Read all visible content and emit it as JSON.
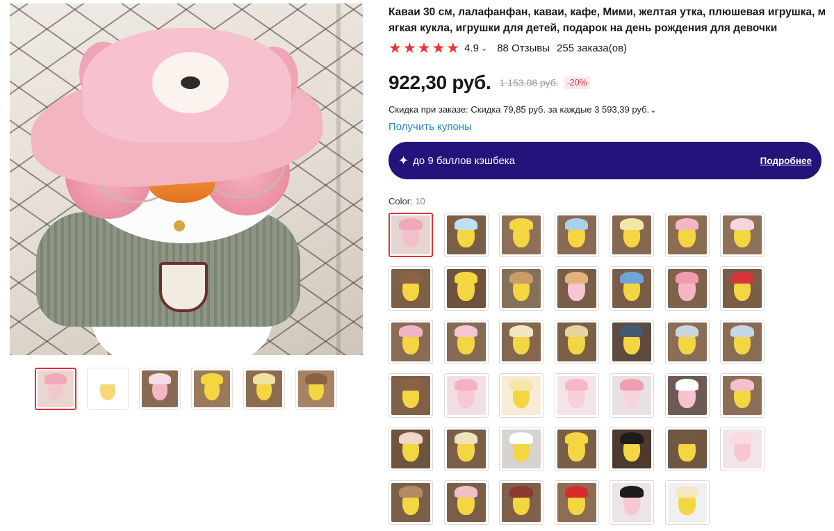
{
  "product": {
    "title": "Каваи 30 см, лалафанфан, каваи, кафе, Мими, желтая утка, плюшевая игрушка, мягкая кукла, игрушки для детей, подарок на день рождения для девочки",
    "rating": "4.9",
    "reviews": "88 Отзывы",
    "orders": "255 заказа(ов)",
    "price": "922,30 руб.",
    "old_price": "1 153,08 руб.",
    "discount_badge": "-20%",
    "order_discount": "Скидка при заказе: Скидка 79,85 руб. за каждые 3 593,39 руб.",
    "coupons_link": "Получить купоны",
    "cashback_text": "до 9 баллов кэшбека",
    "cashback_more": "Подробнее",
    "color_label": "Color:",
    "color_count": "10"
  },
  "colors": {
    "accent_red": "#e0303a",
    "cashback_bg": "#22147a",
    "link_blue": "#1f86c9"
  },
  "gallery": {
    "main_image": "pink-hat-duck-plush-with-glasses",
    "thumbnails": [
      {
        "name": "thumb-pink-hat-duck",
        "bg": "#e8d6cf",
        "blob": "#f2c7cf",
        "hat": "#f0a9b8"
      },
      {
        "name": "thumb-size-chart",
        "bg": "#ffffff",
        "blob": "#f7d77a",
        "hat": "#ffffff"
      },
      {
        "name": "thumb-bunny-duck",
        "bg": "#8a6b52",
        "blob": "#f2b8c5",
        "hat": "#f5dbe2"
      },
      {
        "name": "thumb-yellow-duck",
        "bg": "#9b7a5c",
        "blob": "#f3d641",
        "hat": "#f3d641"
      },
      {
        "name": "thumb-yellow-hat-duck",
        "bg": "#8d6d50",
        "blob": "#f3d641",
        "hat": "#efe1a3"
      },
      {
        "name": "thumb-brown-hat-duck",
        "bg": "#a78263",
        "blob": "#f3d641",
        "hat": "#8a6344"
      }
    ]
  },
  "swatches": [
    {
      "bg": "#e5d4cf",
      "blob": "#f2c0cb",
      "hat": "#f0a9b8"
    },
    {
      "bg": "#7c5e46",
      "blob": "#f3d641",
      "hat": "#bfe0f2"
    },
    {
      "bg": "#8e7058",
      "blob": "#f3d641",
      "hat": "#f3d641"
    },
    {
      "bg": "#8a6a53",
      "blob": "#f3d641",
      "hat": "#a9d1ea"
    },
    {
      "bg": "#86674f",
      "blob": "#f3d641",
      "hat": "#f3e6a9"
    },
    {
      "bg": "#8c6c53",
      "blob": "#f3d641",
      "hat": "#f2b7c3"
    },
    {
      "bg": "#8f715a",
      "blob": "#f3d641",
      "hat": "#f5d6de"
    },
    {
      "bg": "#7e5f47",
      "blob": "#f3d641",
      "hat": "#8a6344"
    },
    {
      "bg": "#6e523e",
      "blob": "#f3d641",
      "hat": "#f3d641"
    },
    {
      "bg": "#857159",
      "blob": "#f3d641",
      "hat": "#c89c6b"
    },
    {
      "bg": "#7a5d48",
      "blob": "#f4c7d2",
      "hat": "#e2b37b"
    },
    {
      "bg": "#7a5d48",
      "blob": "#f3d641",
      "hat": "#6fa4d6"
    },
    {
      "bg": "#806149",
      "blob": "#f3b7c4",
      "hat": "#ef9cb1"
    },
    {
      "bg": "#7b5c47",
      "blob": "#f3d641",
      "hat": "#d6333d"
    },
    {
      "bg": "#8a6c55",
      "blob": "#f3d641",
      "hat": "#f0b4c2"
    },
    {
      "bg": "#876a53",
      "blob": "#f3d641",
      "hat": "#f5c6d1"
    },
    {
      "bg": "#85674f",
      "blob": "#f3d641",
      "hat": "#f3e7c2"
    },
    {
      "bg": "#7c5f49",
      "blob": "#f3d641",
      "hat": "#e6d39e"
    },
    {
      "bg": "#5d4b40",
      "blob": "#f3d641",
      "hat": "#445a74"
    },
    {
      "bg": "#8b6d55",
      "blob": "#f3d641",
      "hat": "#cdd5dd"
    },
    {
      "bg": "#8a6c55",
      "blob": "#f3d641",
      "hat": "#c5d7e6"
    },
    {
      "bg": "#806148",
      "blob": "#f3d641",
      "hat": "#8a6344"
    },
    {
      "bg": "#f2dfe5",
      "blob": "#f6c9d3",
      "hat": "#f4b1c2"
    },
    {
      "bg": "#f7ecd6",
      "blob": "#f3d641",
      "hat": "#f6e7a8"
    },
    {
      "bg": "#f4e3e8",
      "blob": "#f6d1da",
      "hat": "#f7b7c7"
    },
    {
      "bg": "#e8e0e3",
      "blob": "#f7d4dc",
      "hat": "#ef9fb1"
    },
    {
      "bg": "#6e5a55",
      "blob": "#f5c4cf",
      "hat": "#ffffff"
    },
    {
      "bg": "#8d6f57",
      "blob": "#f3d641",
      "hat": "#f4c0cc"
    },
    {
      "bg": "#6e553f",
      "blob": "#f3d641",
      "hat": "#f2d7c7"
    },
    {
      "bg": "#7a5e48",
      "blob": "#f3d641",
      "hat": "#f0e2bd"
    },
    {
      "bg": "#d7d3cf",
      "blob": "#f3d641",
      "hat": "#ffffff"
    },
    {
      "bg": "#7a5d46",
      "blob": "#f3d641",
      "hat": "#f3d641"
    },
    {
      "bg": "#4c3a2f",
      "blob": "#f3d641",
      "hat": "#1c1c1c"
    },
    {
      "bg": "#6f5744",
      "blob": "#f3d641",
      "hat": "#715942"
    },
    {
      "bg": "#f3e4e7",
      "blob": "#f7c6d2",
      "hat": "#f9dbe3"
    },
    {
      "bg": "#7c5f48",
      "blob": "#f3d641",
      "hat": "#b38a65"
    },
    {
      "bg": "#7b5e49",
      "blob": "#f3d641",
      "hat": "#f0c0c8"
    },
    {
      "bg": "#7f614b",
      "blob": "#f3d641",
      "hat": "#8a3b2e"
    },
    {
      "bg": "#8d6e55",
      "blob": "#f3d641",
      "hat": "#d92b2b"
    },
    {
      "bg": "#ece4e6",
      "blob": "#f7c7d3",
      "hat": "#1b1b1b"
    },
    {
      "bg": "#eef0f2",
      "blob": "#f3d641",
      "hat": "#f5e7c0"
    }
  ]
}
